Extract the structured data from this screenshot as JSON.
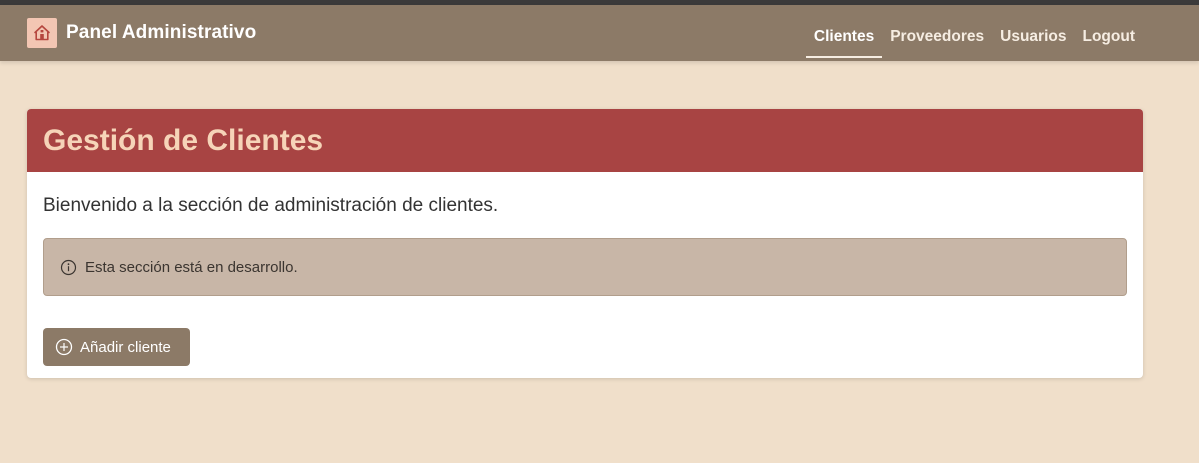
{
  "navbar": {
    "brand": {
      "icon": "home-icon",
      "title": "Panel Administrativo"
    },
    "links": [
      {
        "label": "Clientes",
        "active": true
      },
      {
        "label": "Proveedores",
        "active": false
      },
      {
        "label": "Usuarios",
        "active": false
      },
      {
        "label": "Logout",
        "active": false
      }
    ]
  },
  "card": {
    "title": "Gestión de Clientes",
    "welcome": "Bienvenido a la sección de administración de clientes.",
    "alert": {
      "icon": "info-circle-icon",
      "text": "Esta sección está en desarrollo."
    },
    "add_button": {
      "icon": "plus-circle-icon",
      "label": "Añadir cliente"
    }
  },
  "colors": {
    "navbar": "#8c7a67",
    "page_background": "#f0dfca",
    "card_header": "#a84443",
    "card_title": "#f6d4b8",
    "alert_background": "#c8b6a7",
    "button": "#8c7a67"
  }
}
